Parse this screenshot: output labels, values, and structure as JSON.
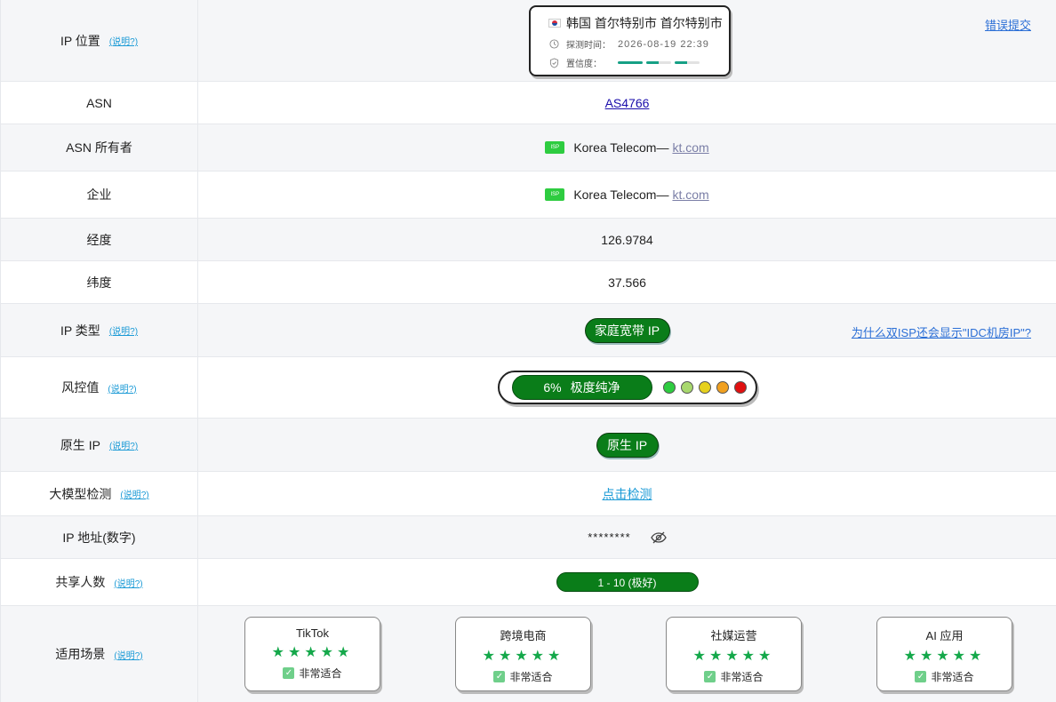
{
  "help_label": "(说明?)",
  "rows": {
    "ip_location": {
      "label": "IP 位置",
      "location": "韩国 首尔特别市 首尔特别市",
      "probe_key": "探测时间：",
      "probe_time": "2026-08-19 22:39",
      "confidence_key": "置信度：",
      "confidence_level": 0.55,
      "report_link": "错误提交"
    },
    "asn": {
      "label": "ASN",
      "value": "AS4766"
    },
    "asn_owner": {
      "label": "ASN 所有者",
      "badge": "ISP",
      "name": "Korea Telecom—",
      "domain": "kt.com"
    },
    "company": {
      "label": "企业",
      "badge": "ISP",
      "name": "Korea Telecom—",
      "domain": "kt.com"
    },
    "longitude": {
      "label": "经度",
      "value": "126.9784"
    },
    "latitude": {
      "label": "纬度",
      "value": "37.566"
    },
    "ip_type": {
      "label": "IP 类型",
      "value": "家庭宽带 IP",
      "right_link": "为什么双ISP还会显示\"IDC机房IP\"?"
    },
    "risk": {
      "label": "风控值",
      "percent": "6%",
      "text": "极度纯净",
      "scale_colors": [
        "#2ecc40",
        "#a8d86e",
        "#e6d11e",
        "#f0a020",
        "#e01010"
      ]
    },
    "native_ip": {
      "label": "原生 IP",
      "value": "原生 IP"
    },
    "llm_detect": {
      "label": "大模型检测",
      "value": "点击检测"
    },
    "ip_numeric": {
      "label": "IP 地址(数字)",
      "value": "********"
    },
    "share": {
      "label": "共享人数",
      "value": "1 - 10 (极好)"
    },
    "scenarios": {
      "label": "适用场景",
      "items": [
        {
          "title": "TikTok",
          "stars": 5,
          "fit": "非常适合"
        },
        {
          "title": "跨境电商",
          "stars": 5,
          "fit": "非常适合"
        },
        {
          "title": "社媒运营",
          "stars": 5,
          "fit": "非常适合"
        },
        {
          "title": "AI 应用",
          "stars": 5,
          "fit": "非常适合"
        }
      ]
    }
  },
  "colors": {
    "accent_green": "#0a7d19",
    "link_blue": "#1a9ad6",
    "row_alt": "#f5f6f8"
  },
  "icons": [
    "flag-kr-icon",
    "clock-icon",
    "shield-check-icon",
    "eye-off-icon",
    "star-icon",
    "check-icon"
  ]
}
